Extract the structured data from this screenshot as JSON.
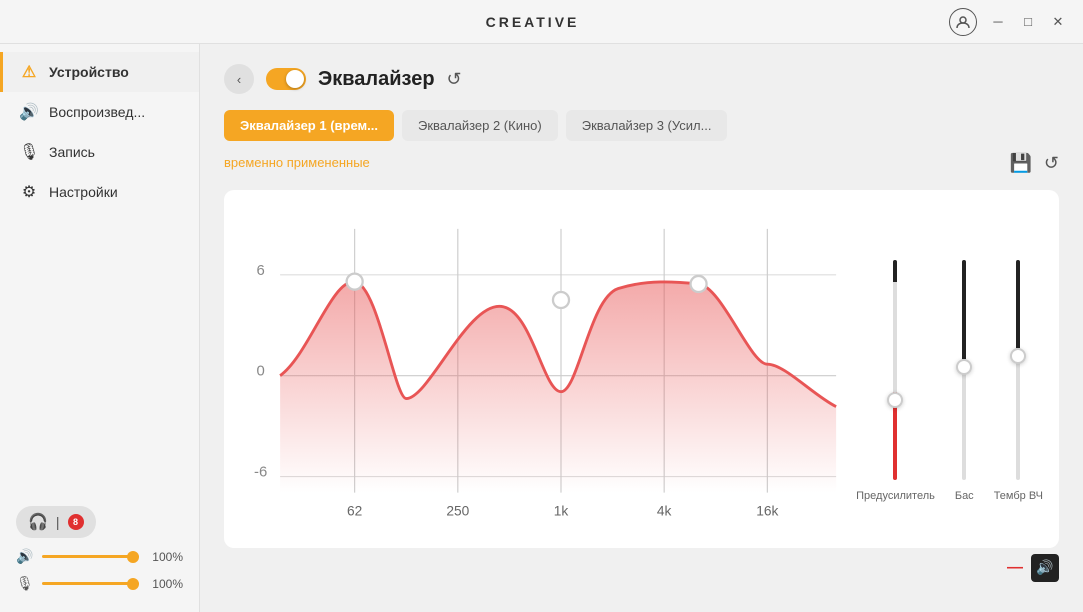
{
  "titlebar": {
    "app_name": "CREATIVE",
    "minimize_label": "─",
    "maximize_label": "□",
    "close_label": "✕"
  },
  "sidebar": {
    "items": [
      {
        "id": "device",
        "label": "Устройство",
        "icon": "⚠",
        "active": true
      },
      {
        "id": "playback",
        "label": "Воспроизвед...",
        "icon": "🔊",
        "active": false
      },
      {
        "id": "record",
        "label": "Запись",
        "icon": "🎙",
        "active": false
      },
      {
        "id": "settings",
        "label": "Настройки",
        "icon": "⚙",
        "active": false
      }
    ],
    "device_badge": {
      "icon": "🎧",
      "dot": "8"
    },
    "volume": {
      "playback_icon": "🔊",
      "playback_value": "100%",
      "mic_icon": "🎙",
      "mic_value": "100%"
    }
  },
  "equalizer": {
    "back_icon": "‹",
    "title": "Эквалайзер",
    "refresh_icon": "↺",
    "presets": [
      {
        "id": "preset1",
        "label": "Эквалайзер 1 (врем...",
        "active": true
      },
      {
        "id": "preset2",
        "label": "Эквалайзер 2 (Кино)",
        "active": false
      },
      {
        "id": "preset3",
        "label": "Эквалайзер 3 (Усил...",
        "active": false
      }
    ],
    "status": "временно примененные",
    "save_icon": "💾",
    "reset_icon": "↺",
    "chart": {
      "freq_labels": [
        "62",
        "250",
        "1k",
        "4k",
        "16k"
      ],
      "y_labels": [
        "6",
        "0",
        "-6"
      ],
      "curve_color": "#e85555",
      "fill_color": "rgba(232,85,85,0.25)"
    },
    "sliders": [
      {
        "id": "preamp",
        "label": "Предусилитель",
        "thumb_pos_pct": 60,
        "fill_top_pct": 10,
        "fill_bottom_pct": 40
      },
      {
        "id": "bass",
        "label": "Бас",
        "thumb_pos_pct": 45,
        "fill_top_pct": 45,
        "fill_bottom_pct": 0
      },
      {
        "id": "treble",
        "label": "Тембр ВЧ",
        "thumb_pos_pct": 40,
        "fill_top_pct": 40,
        "fill_bottom_pct": 0
      }
    ]
  },
  "bottom_bar": {
    "minus_icon": "—",
    "speaker_icon": "🔊"
  }
}
